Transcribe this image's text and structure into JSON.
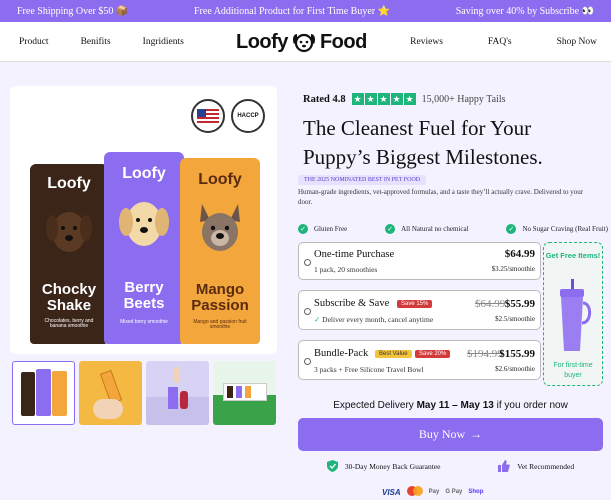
{
  "announcement": {
    "left": "Free Shipping Over $50 📦",
    "center": "Free Additional Product for First Time Buyer ⭐",
    "right": "Saving over 40% by Subscribe 👀"
  },
  "header": {
    "nav_left": [
      "Product",
      "Benifits",
      "Ingridients"
    ],
    "logo_word1": "Loofy",
    "logo_word2": "Food",
    "nav_right": [
      "Reviews",
      "FAQ's",
      "Shop Now"
    ]
  },
  "gallery": {
    "badges": [
      "MADE IN USA",
      "HACCP"
    ],
    "bars": [
      {
        "brand": "Loofy",
        "name": "Chocky Shake",
        "sub": "Chocolates, berry and banana smoothie",
        "color": "#3b2418"
      },
      {
        "brand": "Loofy",
        "name": "Berry Beets",
        "sub": "Mixed berry smoothie",
        "color": "#8c6df0"
      },
      {
        "brand": "Loofy",
        "name": "Mango Passion",
        "sub": "Mango and passion fruit smoothie",
        "color": "#f3a63b"
      }
    ]
  },
  "product": {
    "rating_label": "Rated 4.8",
    "reviews": "15,000+ Happy Tails",
    "title": "The Cleanest Fuel for Your Puppy’s Biggest Milestones.",
    "nominated": "THE 2025 NOMINATED BEST IN PET FOOD",
    "description": "Human-grade ingredients, vet-approved formulas, and a taste they’ll actually crave. Delivered to your door.",
    "features": [
      "Gluten Free",
      "All Natural no chemical",
      "No Sugar Craving (Real Fruit)"
    ]
  },
  "options": [
    {
      "title": "One-time Purchase",
      "sub": "1 pack, 20 smoothies",
      "price": "$64.99",
      "unit": "$3.25/smoothie"
    },
    {
      "title": "Subscribe & Save",
      "tag": "Save 15%",
      "sub": "Deliver every month, cancel anytime",
      "old_price": "$64.99",
      "price": "$55.99",
      "unit": "$2.5/smoothie"
    },
    {
      "title": "Bundle-Pack",
      "tag1": "Best Value",
      "tag2": "Save 20%",
      "sub": "3 packs + Free Silicone Travel Bowl",
      "old_price": "$194.99",
      "price": "$155.99",
      "unit": "$2.6/smoothie"
    }
  ],
  "freebie": {
    "heading": "Get Free Items!",
    "footer": "For first-time buyer"
  },
  "delivery": {
    "prefix": "Expected Delivery ",
    "dates": "May 11 – May 13",
    "suffix": " if you order now"
  },
  "buy_button": "Buy Now",
  "guarantees": [
    "30-Day Money Back Guarantee",
    "Vet Recommended"
  ],
  "payments": [
    "VISA",
    "Mastercard",
    "Pay",
    "G Pay",
    "Shop"
  ],
  "colors": {
    "accent": "#8c6df0",
    "green": "#1fb57a"
  }
}
